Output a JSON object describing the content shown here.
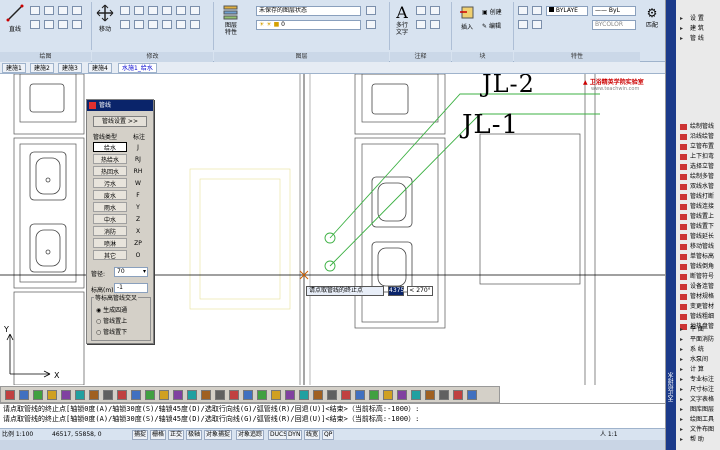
{
  "ribbon": {
    "groups": [
      {
        "label": "绘图"
      },
      {
        "label": "修改"
      },
      {
        "label": "图层"
      },
      {
        "label": "注释"
      },
      {
        "label": "块"
      },
      {
        "label": "特性"
      }
    ],
    "line_label": "直线",
    "move_label": "移动",
    "layer_props_label": "图层\n特性",
    "layer_state": "未保存的图层状态",
    "layer_current": "0",
    "mtext_label": "多行\n文字",
    "insert_label": "插入",
    "create_label": "创建",
    "edit_label": "编辑",
    "bylayer_color": "BYLAYE",
    "bylayer_linetype": "ByL",
    "bycolor": "BYCOLOR",
    "tiquan_label": "匹配"
  },
  "tabs": [
    "建施1",
    "建施2",
    "建施3",
    "建施4",
    "水施1_给水"
  ],
  "active_tab": 4,
  "drawing": {
    "label_jl2": "JL-2",
    "label_jl1": "JL-1",
    "watermark": "卫浴精英学院实验室",
    "watermark_url": "www.teachwin.com"
  },
  "pipe_panel": {
    "title": "管线",
    "settings_btn": "管线设置 >>",
    "col_type": "管线类型",
    "col_mark": "标注",
    "types": [
      {
        "name": "给水",
        "code": "J"
      },
      {
        "name": "热给水",
        "code": "RJ"
      },
      {
        "name": "热回水",
        "code": "RH"
      },
      {
        "name": "污水",
        "code": "W"
      },
      {
        "name": "废水",
        "code": "F"
      },
      {
        "name": "雨水",
        "code": "Y"
      },
      {
        "name": "中水",
        "code": "Z"
      },
      {
        "name": "消防",
        "code": "X"
      },
      {
        "name": "喷淋",
        "code": "ZP"
      },
      {
        "name": "其它",
        "code": "O"
      }
    ],
    "diameter_label": "管径:",
    "diameter_value": "70",
    "elevation_label": "标高(m)",
    "elevation_value": "-1",
    "cross_title": "等标高管线交叉",
    "options": [
      "生成四通",
      "管线置上",
      "管线置下"
    ],
    "selected_option": 0
  },
  "tooltip": {
    "prompt": "请点取管线的终止点",
    "distance": "4375",
    "angle": "< 270°"
  },
  "command": {
    "line1": "请点取管线的终止点[轴锁0度(A)/轴锁30度(S)/轴锁45度(D)/选取行向线(G)/弧管线(R)/回退(U)]<结束>（当前标高:-1000）:",
    "line2": "请点取管线的终止点[轴锁0度(A)/轴锁30度(S)/轴锁45度(D)/选取行向线(G)/弧管线(R)/回退(U)]<结束>（当前标高:-1000）:"
  },
  "status": {
    "scale": "比例 1:100",
    "coords": "46517, 55858, 0",
    "buttons": [
      "捕捉",
      "栅格",
      "正交",
      "极轴",
      "对象捕捉",
      "对象追踪",
      "DUCS",
      "DYN",
      "线宽",
      "QP"
    ],
    "ratio": "人 1:1"
  },
  "right_panel": {
    "top_items": [
      "设 置",
      "建 筑",
      "管 线"
    ],
    "tools": [
      "绘制管线",
      "沿线绘管",
      "立管布置",
      "上下扣弯",
      "选择立管",
      "绘制多管",
      "双线水管",
      "管线打断",
      "管线连接",
      "管线置上",
      "管线置下",
      "管线延长",
      "移动管线",
      "单管标高",
      "管线倒角",
      "断管符号",
      "设备连管",
      "管材规格",
      "变更管材",
      "管线粗细",
      "地热盘管"
    ],
    "bottom_items": [
      "平 面",
      "平面消防",
      "系 统",
      "水泵间",
      "计 算",
      "专业标注",
      "尺寸标注",
      "文字表格",
      "图库图层",
      "绘图工具",
      "文件布图",
      "帮 助"
    ],
    "side_label": "天正给排水"
  },
  "colors": {
    "accent": "#0a246a",
    "ribbon": "#d8e3f0",
    "pipe_green": "#3cb043",
    "line_red": "#c00000"
  }
}
